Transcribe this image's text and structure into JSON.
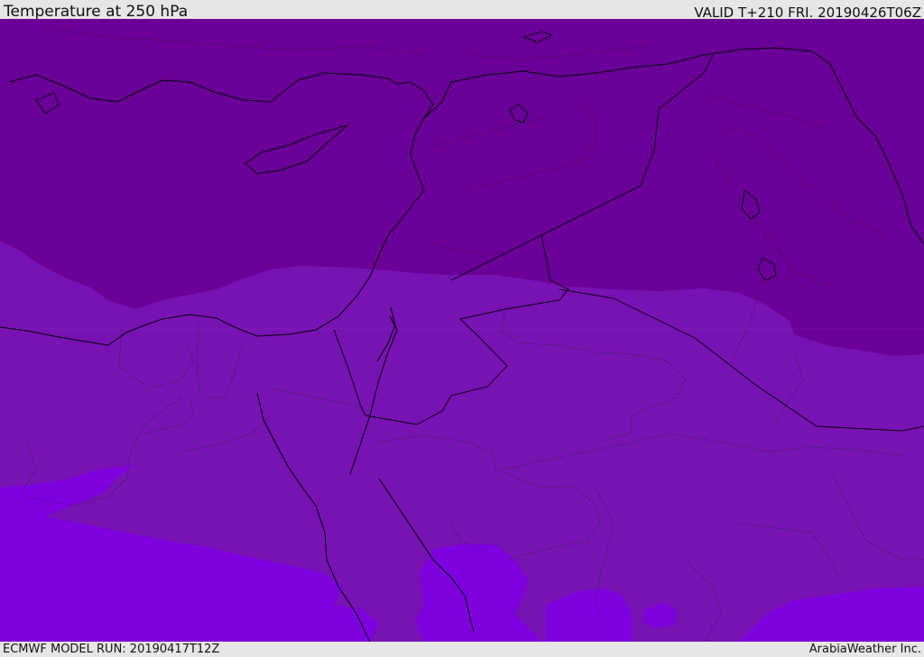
{
  "header": {
    "title": "Temperature at 250 hPa",
    "valid_time": "VALID T+210 FRI. 20190426T06Z"
  },
  "footer": {
    "model_run": "ECMWF MODEL RUN: 20190417T12Z",
    "credit": "ArabiaWeather Inc."
  },
  "colors": {
    "band_cold": "#6a0097",
    "band_mid": "#7712b3",
    "band_warm": "#7f00df",
    "coastline": "#000000",
    "border": "#000000"
  }
}
